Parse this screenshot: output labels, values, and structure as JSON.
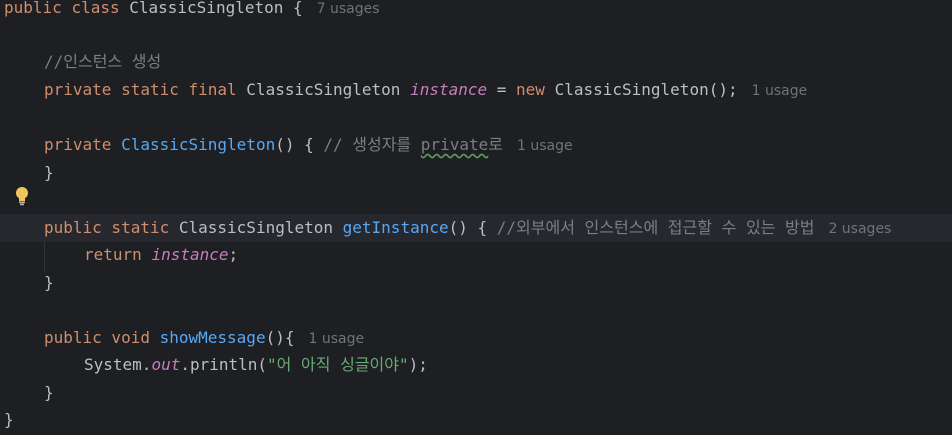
{
  "code": {
    "class_decl": {
      "kw_public": "public",
      "kw_class": "class",
      "name": "ClassicSingleton",
      "brace": " {",
      "hint": "7 usages"
    },
    "comment_instance": "//인스턴스 생성",
    "field_decl": {
      "kw": "private static final",
      "type": "ClassicSingleton",
      "name": "instance",
      "eq": " = ",
      "kw_new": "new",
      "ctor": "ClassicSingleton();",
      "hint": "1 usage"
    },
    "ctor_decl": {
      "kw": "private",
      "name": "ClassicSingleton",
      "rest": "() { ",
      "comment_prefix": "// 생성자를 ",
      "comment_typo": "private",
      "comment_suffix": "로",
      "hint": "1 usage"
    },
    "close_brace": "}",
    "get_decl": {
      "kw": "public static",
      "type": "ClassicSingleton",
      "name": "getInstance",
      "rest": "() { ",
      "comment": "//외부에서 인스턴스에 접근할 수 있는 방법",
      "hint": "2 usages"
    },
    "return_stmt": {
      "kw": "return",
      "name": "instance",
      "semi": ";"
    },
    "show_decl": {
      "kw": "public void",
      "name": "showMessage",
      "rest": "(){",
      "hint": "1 usage"
    },
    "println_stmt": {
      "obj": "System.",
      "field": "out",
      "method": ".println(",
      "string": "\"어 아직 싱글이야\"",
      "end": ");"
    }
  },
  "colors": {
    "background": "#1e1f22",
    "keyword": "#cf8e6d",
    "function": "#56a8f5",
    "static_field": "#c77dbb",
    "string": "#6aab73",
    "comment": "#7a7e85",
    "inlay_hint": "#6f737a"
  },
  "icons": {
    "gutter": "lightbulb-icon"
  }
}
